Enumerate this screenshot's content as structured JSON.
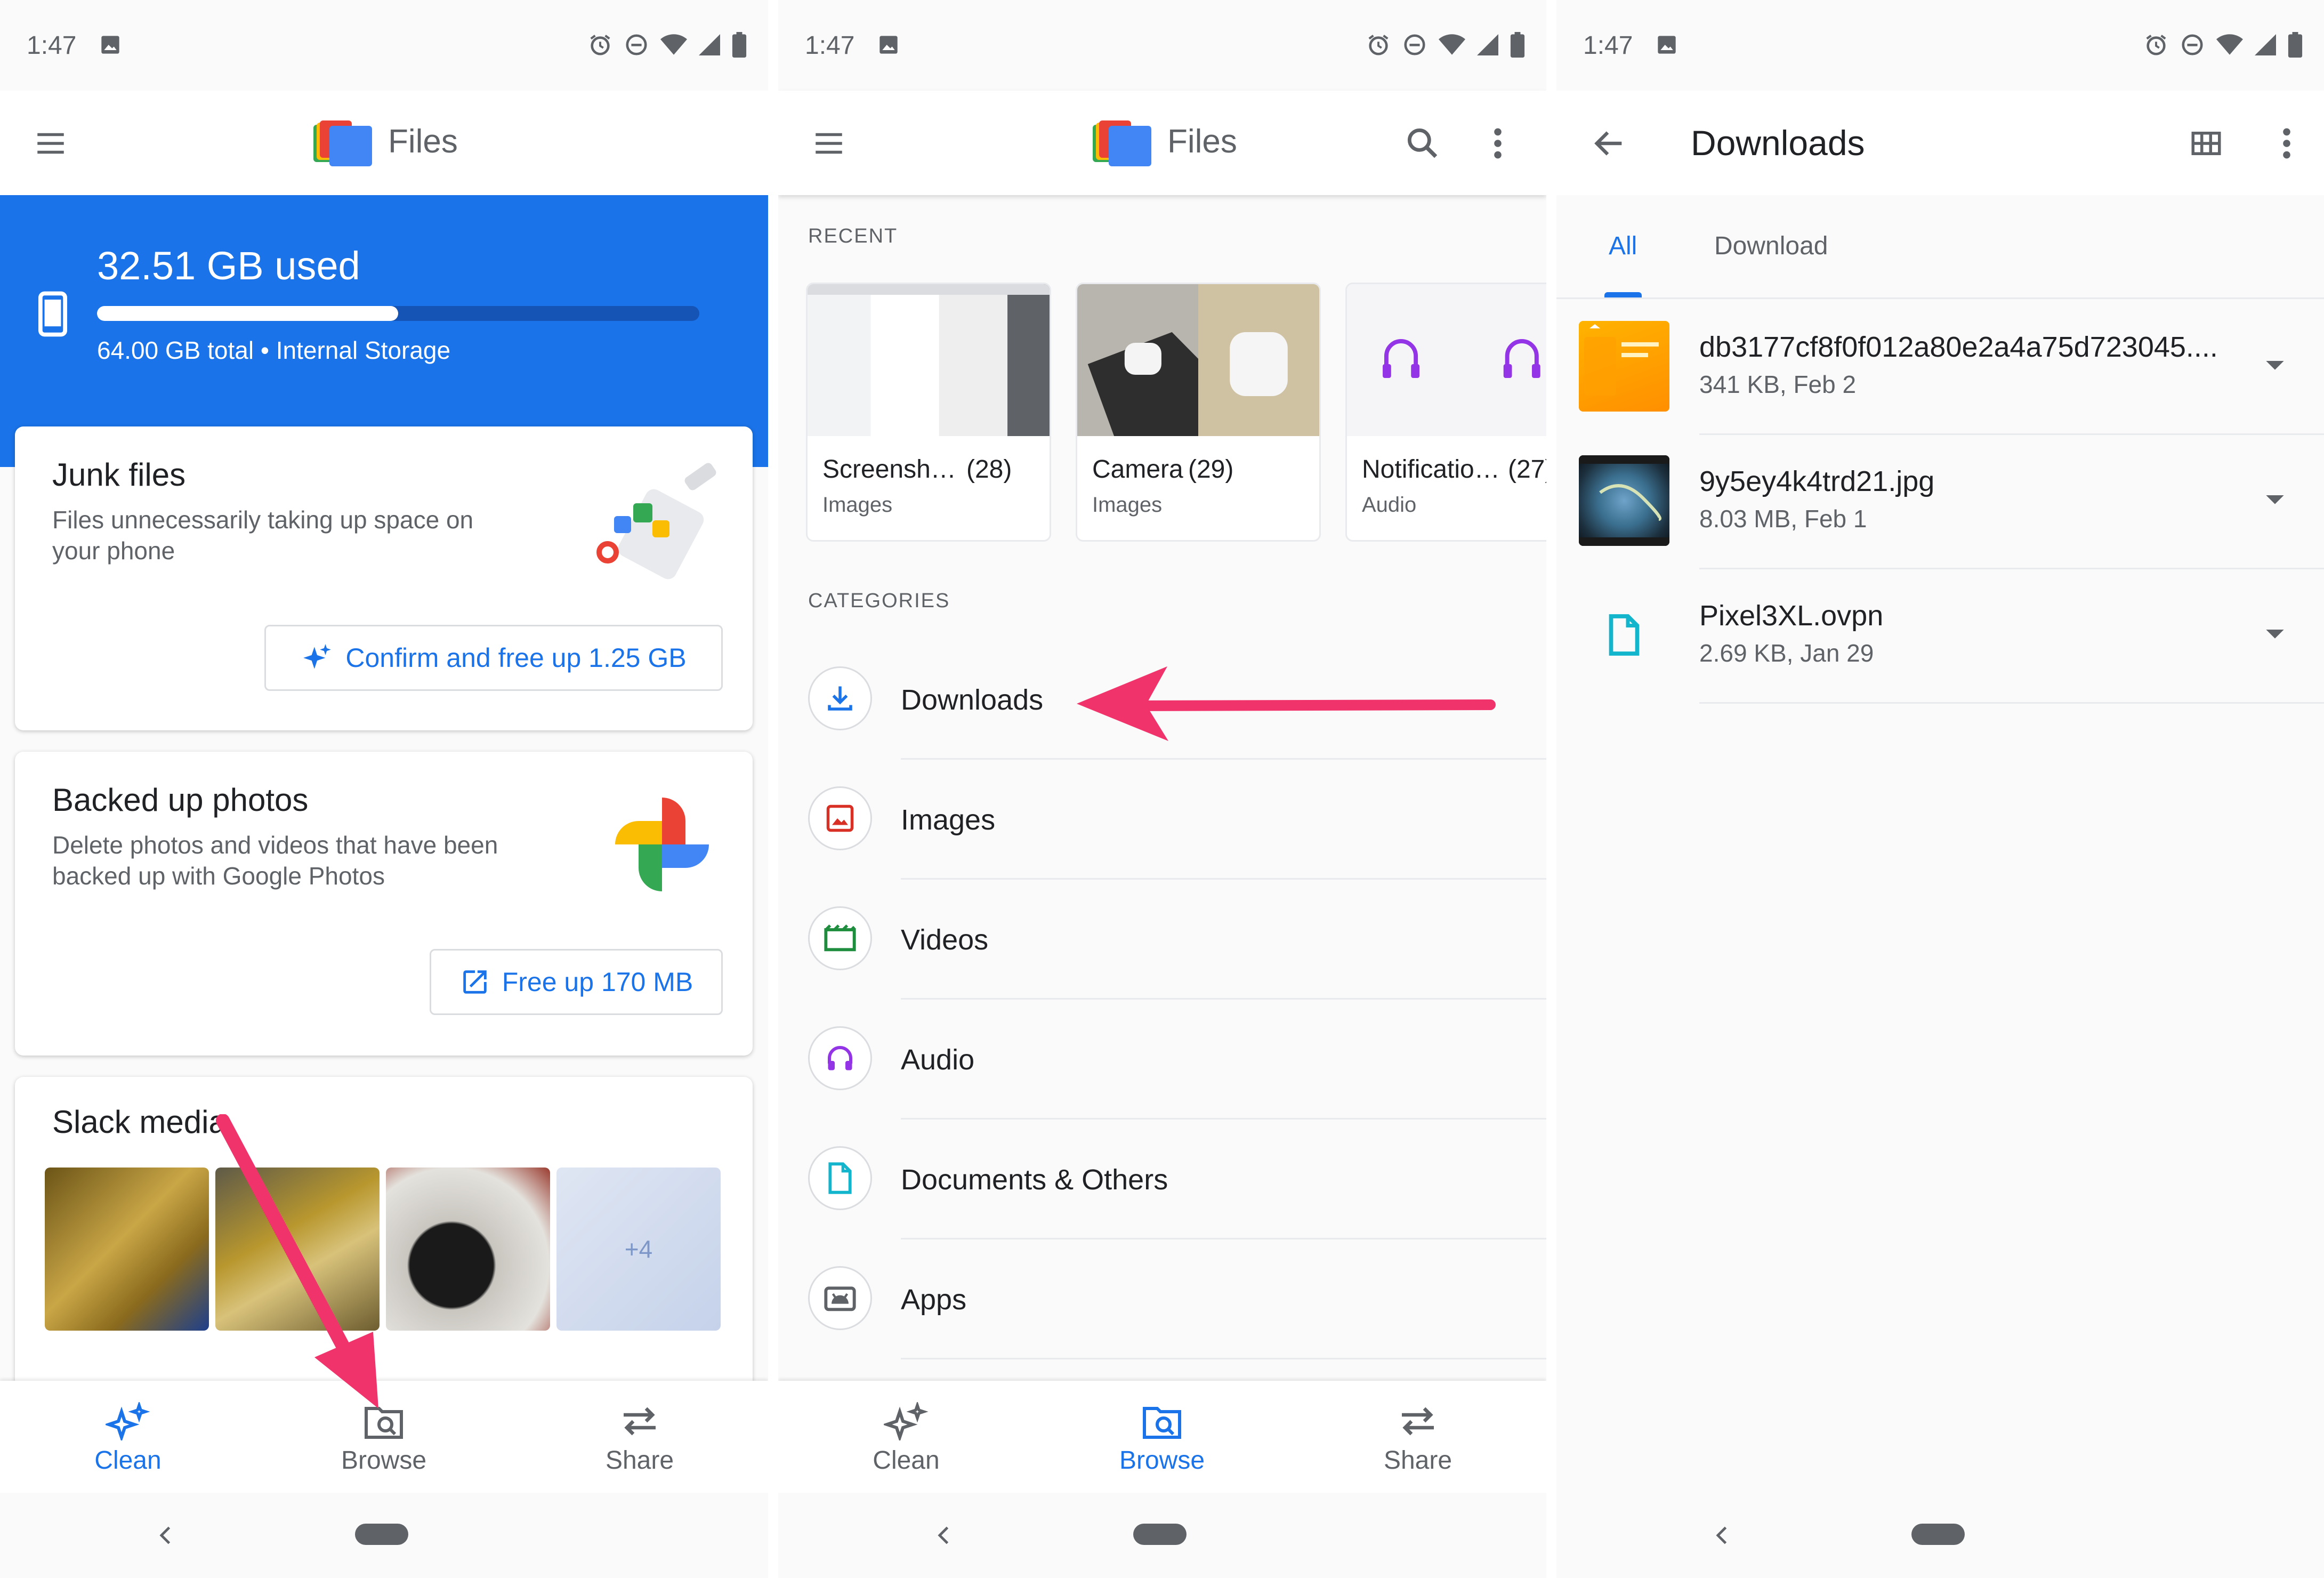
{
  "status": {
    "time": "1:47"
  },
  "screen1": {
    "app_title": "Files",
    "storage": {
      "used": "32.51 GB used",
      "subtitle": "64.00 GB total • Internal Storage",
      "fill_fraction": 0.5
    },
    "junk": {
      "title": "Junk files",
      "desc": "Files unnecessarily taking up space on your phone",
      "button": "Confirm and free up 1.25 GB"
    },
    "backed": {
      "title": "Backed up photos",
      "desc": "Delete photos and videos that have been backed up with Google Photos",
      "button": "Free up 170 MB"
    },
    "slack": {
      "title": "Slack media",
      "more": "+4"
    },
    "nav": {
      "clean": "Clean",
      "browse": "Browse",
      "share": "Share",
      "active": "clean"
    }
  },
  "screen2": {
    "app_title": "Files",
    "recent_label": "RECENT",
    "recent": [
      {
        "title": "Screensh…",
        "count": "(28)",
        "sub": "Images"
      },
      {
        "title": "Camera",
        "count": "(29)",
        "sub": "Images"
      },
      {
        "title": "Notificatio…",
        "count": "(27)",
        "sub": "Audio"
      }
    ],
    "categories_label": "CATEGORIES",
    "categories": [
      {
        "label": "Downloads",
        "icon": "download-icon",
        "color": "#1a73e8"
      },
      {
        "label": "Images",
        "icon": "image-icon",
        "color": "#d93025"
      },
      {
        "label": "Videos",
        "icon": "video-icon",
        "color": "#1e8e3e"
      },
      {
        "label": "Audio",
        "icon": "headphones-icon",
        "color": "#9334e6"
      },
      {
        "label": "Documents & Others",
        "icon": "document-icon",
        "color": "#12b5cb"
      },
      {
        "label": "Apps",
        "icon": "android-icon",
        "color": "#5f6368"
      }
    ],
    "nav": {
      "clean": "Clean",
      "browse": "Browse",
      "share": "Share",
      "active": "browse"
    }
  },
  "screen3": {
    "title": "Downloads",
    "tabs": [
      "All",
      "Download"
    ],
    "files": [
      {
        "name": "db3177cf8f0f012a80e2a4a75d723045....",
        "meta": "341 KB, Feb 2"
      },
      {
        "name": "9y5ey4k4trd21.jpg",
        "meta": "8.03 MB, Feb 1"
      },
      {
        "name": "Pixel3XL.ovpn",
        "meta": "2.69 KB, Jan 29"
      }
    ]
  },
  "colors": {
    "accent": "#1a73e8",
    "arrow": "#f0336a",
    "storage_bg": "#1a73e8"
  }
}
